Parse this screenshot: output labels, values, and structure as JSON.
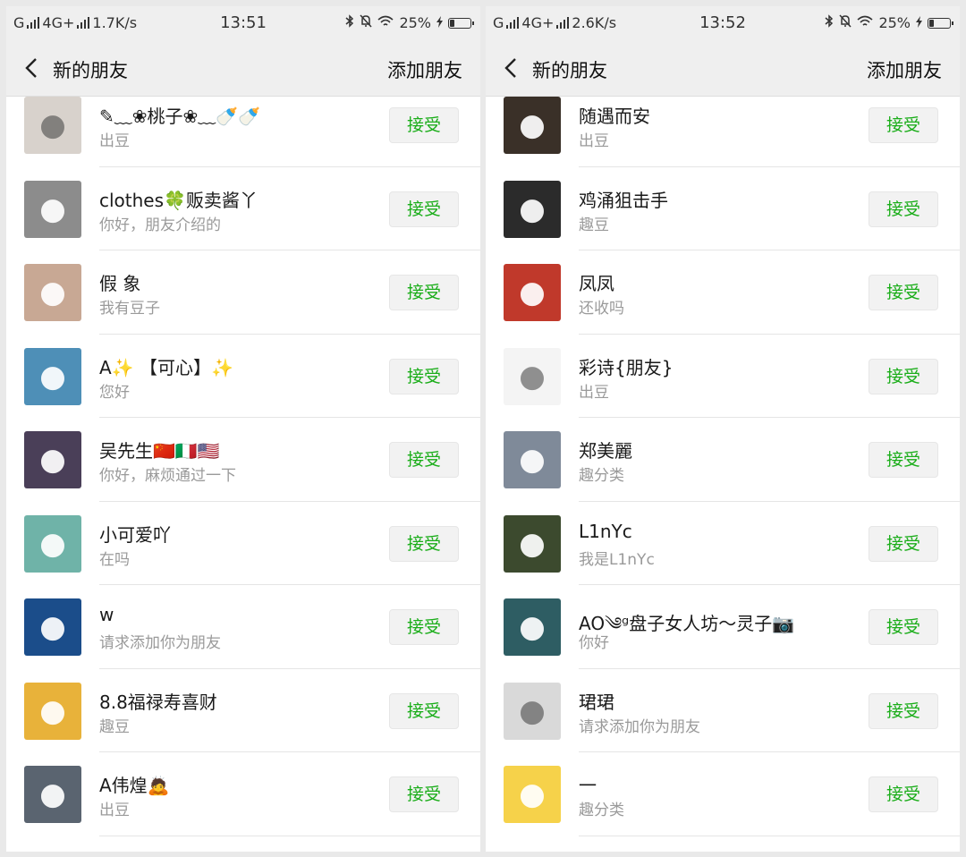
{
  "screens": [
    {
      "status": {
        "network_left": "G",
        "network_type": "4G+",
        "speed": "1.7K/s",
        "time": "13:51",
        "battery": "25%",
        "battery_level": 0.25
      },
      "nav": {
        "title": "新的朋友",
        "action": "添加朋友"
      },
      "accept_label": "接受",
      "requests": [
        {
          "name": "✎﹏❀桃子❀﹏🍼🍼",
          "message": "出豆",
          "avatar_color": "#d8d2cc",
          "avatar_icon": "person-photo"
        },
        {
          "name": "clothes🍀贩卖酱丫",
          "message": "你好，朋友介绍的",
          "avatar_color": "#8c8c8c",
          "avatar_icon": "couple-photo"
        },
        {
          "name": "假 象",
          "message": "我有豆子",
          "avatar_color": "#c8a894",
          "avatar_icon": "kids-photo"
        },
        {
          "name": "A✨ 【可心】✨",
          "message": "您好",
          "avatar_color": "#4e8fb7",
          "avatar_icon": "cartoon-squid"
        },
        {
          "name": "吴先生🇨🇳🇮🇹🇺🇸",
          "message": "你好，麻烦通过一下",
          "avatar_color": "#4a3f58",
          "avatar_icon": "anime-boy"
        },
        {
          "name": "小可爱吖",
          "message": "在吗",
          "avatar_color": "#6fb3a8",
          "avatar_icon": "egg-creature"
        },
        {
          "name": "w",
          "message": "请求添加你为朋友",
          "avatar_color": "#1b4d8a",
          "avatar_icon": "e-logo"
        },
        {
          "name": "8.8福禄寿喜财",
          "message": "趣豆",
          "avatar_color": "#e8b23a",
          "avatar_icon": "cartoon-luffy"
        },
        {
          "name": "A伟煌🙇",
          "message": "出豆",
          "avatar_color": "#5a6470",
          "avatar_icon": "office-photo"
        }
      ]
    },
    {
      "status": {
        "network_left": "G",
        "network_type": "4G+",
        "speed": "2.6K/s",
        "time": "13:52",
        "battery": "25%",
        "battery_level": 0.25
      },
      "nav": {
        "title": "新的朋友",
        "action": "添加朋友"
      },
      "accept_label": "接受",
      "requests": [
        {
          "name": "随遇而安",
          "message": "出豆",
          "avatar_color": "#3a3028",
          "avatar_icon": "group-photo"
        },
        {
          "name": "鸡涌狙击手",
          "message": "趣豆",
          "avatar_color": "#2b2b2b",
          "avatar_icon": "man-photo"
        },
        {
          "name": "凤凤",
          "message": "还收吗",
          "avatar_color": "#c0392b",
          "avatar_icon": "red-photo"
        },
        {
          "name": "彩诗{朋友}",
          "message": "出豆",
          "avatar_color": "#f4f4f4",
          "avatar_icon": "doodle"
        },
        {
          "name": "郑美麗",
          "message": "趣分类",
          "avatar_color": "#7f8a99",
          "avatar_icon": "mountain-photo"
        },
        {
          "name": "L1nYc",
          "message": "我是L1nYc",
          "avatar_color": "#3c4a2e",
          "avatar_icon": "rider-photo"
        },
        {
          "name": "AO༄ᵍ盘子女人坊～灵子📷",
          "message": "你好",
          "avatar_color": "#2e5d63",
          "avatar_icon": "silhouette-photo"
        },
        {
          "name": "珺珺",
          "message": "请求添加你为朋友",
          "avatar_color": "#d9d9d9",
          "avatar_icon": "man-portrait"
        },
        {
          "name": "一",
          "message": "趣分类",
          "avatar_color": "#f6d24a",
          "avatar_icon": "cartoon-girl"
        }
      ]
    }
  ]
}
